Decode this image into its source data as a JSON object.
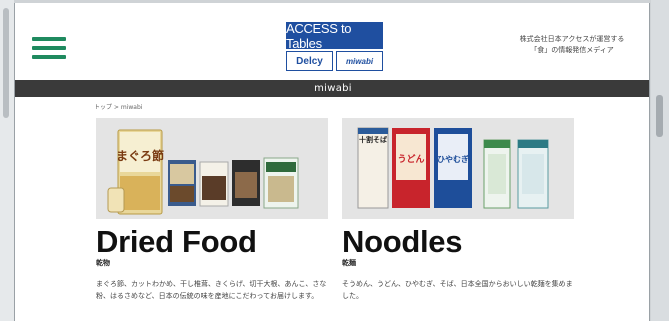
{
  "header": {
    "logo_text": "ACCESS to Tables",
    "logo_chip_left": "Delcy",
    "logo_chip_right": "miwabi",
    "tagline_line1": "株式会社日本アクセスが運営する",
    "tagline_line2": "「食」の情報発信メディア"
  },
  "subbar": {
    "label": "miwabi"
  },
  "breadcrumb": {
    "text": "トップ > miwabi"
  },
  "cards": [
    {
      "title": "Dried Food",
      "subtitle": "乾物",
      "description": "まぐろ節、カットわかめ、干し椎茸、きくらげ、切干大根、あんこ、さな粉、はるさめなど、日本の伝統の味を産地にこだわってお届けします。",
      "photo_labels": [
        "まぐろ節"
      ]
    },
    {
      "title": "Noodles",
      "subtitle": "乾麺",
      "description": "そうめん、うどん、ひやむぎ、そば、日本全国からおいしい乾麺を集めました。",
      "photo_labels": [
        "十割そば",
        "うどん",
        "ひやむぎ"
      ]
    }
  ],
  "colors": {
    "hamburger": "#1f8a5f",
    "brand_blue": "#1f4fa0",
    "subbar": "#3a3a3a"
  }
}
